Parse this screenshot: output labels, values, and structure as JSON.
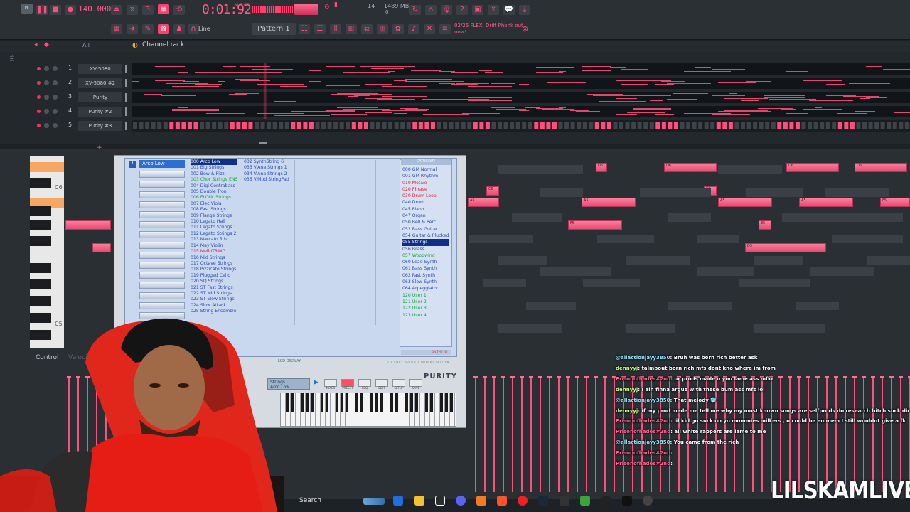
{
  "toolbar": {
    "tempo": "140.000",
    "time": "0:01:92",
    "time_sub": "M:S:CS",
    "cpu": "14",
    "ram": "1489 MB",
    "ram_sub": "0",
    "pattern": "Pattern 1",
    "snap_label": "Line",
    "hint": "02/26 FLEX: Drift Phonk out now!"
  },
  "channel_rack": {
    "filter": "All",
    "title": "Channel rack",
    "channels": [
      {
        "num": "1",
        "name": "XV-5080"
      },
      {
        "num": "2",
        "name": "XV-5080 #2"
      },
      {
        "num": "3",
        "name": "Purity"
      },
      {
        "num": "4",
        "name": "Purity #2"
      },
      {
        "num": "5",
        "name": "Purity #3"
      }
    ]
  },
  "piano_roll": {
    "c6": "C6",
    "c5": "C5",
    "note_labels": [
      "D6",
      "D6",
      "D6",
      "D6",
      "C6",
      "C6",
      "A5",
      "A5",
      "A5",
      "A5",
      "F5",
      "F5",
      "E5",
      "D5"
    ]
  },
  "plugin": {
    "slot_number": "1",
    "current_patch": "Arco Low",
    "patches_col1": [
      "000 Arco Low",
      "001 Big Strings",
      "002 Bow & Pizz",
      "003 Chor Strings ENS",
      "004 Digi Contrabass",
      "005 Double Tron",
      "006 ELOtic Strings",
      "007 Elec Viola",
      "008 Fast Strings",
      "009 Flange Strings",
      "010 Legato Hall",
      "011 Legato Strings 1",
      "012 Legato Strings 2",
      "013 Marcato 5th",
      "014 May Violin",
      "015 MelloTRING",
      "016 Mid Strings",
      "017 Octave Strings",
      "018 Pizzicato Strings",
      "019 Plugged Cello",
      "020 SQ Strings",
      "021 ST Fast Strings",
      "022 ST Mid Strings",
      "023 ST Slow Strings",
      "024 Slow Attack",
      "025 String Ensemble"
    ],
    "patches_col2": [
      "032 SynthString 6",
      "033 V.Ana Strings 1",
      "034 V.Ana Strings 2",
      "035 V.Mod StringPad"
    ],
    "category_header": "CATEGORY",
    "categories": [
      "000 GM Normal",
      "001 GM Rhythm",
      "010 Motive",
      "020 Phrase",
      "030 Drum Loop",
      "040 Drum",
      "045 Piano",
      "047 Organ",
      "050 Bell & Perc",
      "052 Bass Guitar",
      "054 Guitar & Plucked",
      "055 Strings",
      "056 Brass",
      "057 Woodwind",
      "060 Lead Synth",
      "061 Bass Synth",
      "062 Fast Synth",
      "063 Slow Synth",
      "064 Arpeggiator",
      "120 User 1",
      "121 User 2",
      "122 User 3",
      "123 User 4"
    ],
    "cat_footer": "ON THE FLY",
    "lcd_label": "LCD DISPLAY",
    "brand_text": "VIRTUAL SOUND WORKSTATION",
    "name": "PURITY",
    "preset_line1": "Strings",
    "preset_line2": "Arco Low",
    "buttons": [
      "MIXER",
      "PRESET",
      "SEQ",
      "EDIT",
      "SETUP",
      "SAVE"
    ]
  },
  "control": {
    "label": "Control",
    "target": "Velocity"
  },
  "chat": [
    {
      "user": "@allactionjayy3850",
      "msg": ": Bruh was born rich better ask",
      "cls": "u"
    },
    {
      "user": "dennyyj",
      "msg": ": talmbout born rich mfs dont kno where im from",
      "cls": "u2"
    },
    {
      "user": "Prisonofhades#2nd",
      "msg": ": ur prods made u you lame ass mfkr",
      "cls": "u3"
    },
    {
      "user": "dennyyj",
      "msg": ": I ain finna argue with these bum ass mfs lol",
      "cls": "u2"
    },
    {
      "user": "@allactionjayy3850",
      "msg": ": That melody 🥶",
      "cls": "u"
    },
    {
      "user": "dennyyj",
      "msg": ": if my prod made me tell me why my most known songs are selfprods do research bitch suck dick",
      "cls": "u2"
    },
    {
      "user": "Prisonofhades#2nd",
      "msg": ": lil kid go suck on yo mommies milkers , u could be enimem I still wouldnt give a fk",
      "cls": "u3"
    },
    {
      "user": "Prisonofhades#2nd",
      "msg": ": all white rappers are lame to me",
      "cls": "u3"
    },
    {
      "user": "@allactionjayy3850",
      "msg": ": You came from the rich",
      "cls": "u"
    },
    {
      "user": "Prisonofhades#2nd",
      "msg": ":",
      "cls": "u3"
    },
    {
      "user": "Prisonofhades#2nd",
      "msg": ":",
      "cls": "u3"
    }
  ],
  "taskbar": {
    "search": "Search"
  },
  "overlay": {
    "logo": "LILSKAMLIVE"
  },
  "colors": {
    "accent": "#ff4f7d",
    "note": "#ef5b80",
    "plugin_blue": "#2d6ed1"
  }
}
